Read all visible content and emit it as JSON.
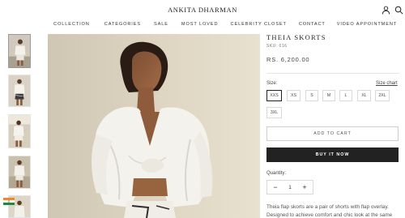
{
  "header": {
    "brand": "ANKITA DHARMAN",
    "nav": [
      "COLLECTION",
      "CATEGORIES",
      "SALE",
      "MOST LOVED",
      "CELEBRITY CLOSET",
      "CONTACT",
      "VIDEO APPOINTMENT"
    ],
    "icons": [
      "user-icon",
      "search-icon"
    ]
  },
  "gallery": {
    "thumbnails": [
      "thumbnail-1",
      "thumbnail-2",
      "thumbnail-3",
      "thumbnail-4",
      "thumbnail-5"
    ],
    "active_index": 0
  },
  "product": {
    "title": "THEIA SKORTS",
    "sku": "SKU: 016",
    "price": "RS. 6,200.00",
    "size_label": "Size:",
    "size_chart_label": "Size chart",
    "sizes": [
      "XXS",
      "XS",
      "S",
      "M",
      "L",
      "XL",
      "2XL",
      "3XL"
    ],
    "selected_size": "XXS",
    "add_to_cart_label": "ADD TO CART",
    "buy_now_label": "BUY IT NOW",
    "quantity_label": "Quantity:",
    "quantity_value": "1",
    "minus_label": "−",
    "plus_label": "+",
    "description_line1": "Theia flap skorts are a pair of shorts with flap overlay.",
    "description_line2": "Designed to achieve comfort and chic look at the same"
  }
}
